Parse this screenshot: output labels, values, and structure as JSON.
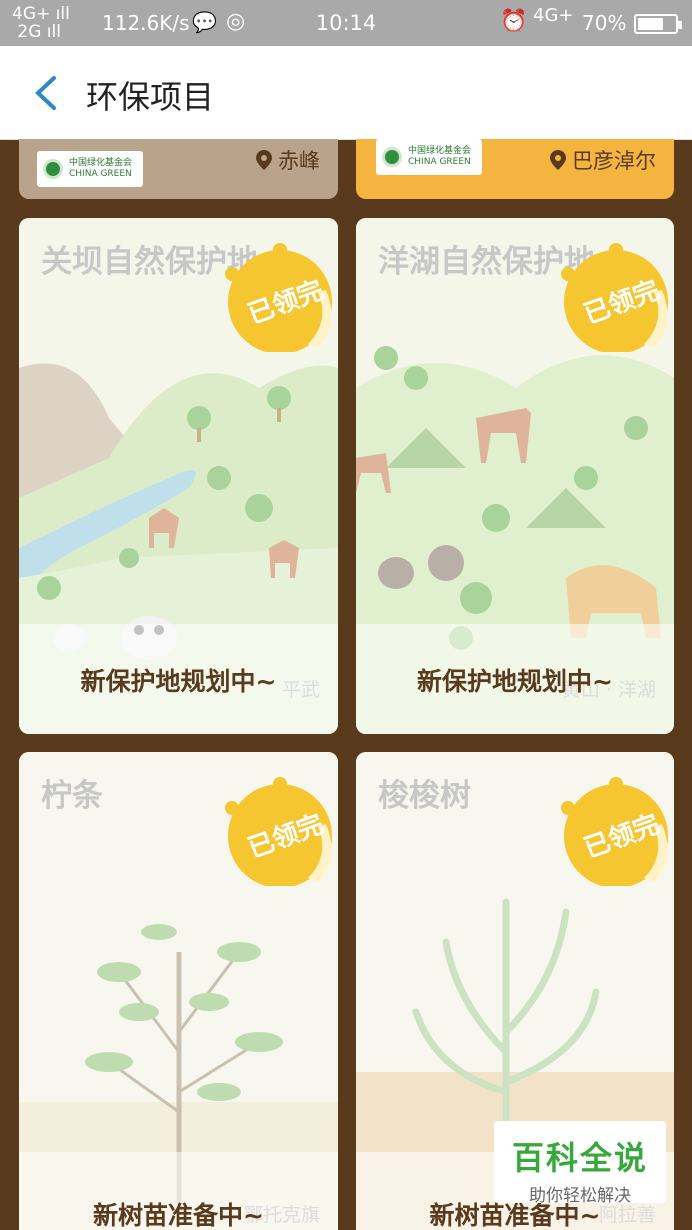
{
  "status": {
    "net_top": "4G+",
    "net_bottom": "2G",
    "speed": "112.6K/s",
    "time": "10:14",
    "net2": "4G+",
    "battery_text": "70%",
    "battery_level": 0.7
  },
  "header": {
    "title": "环保项目"
  },
  "top_cards": [
    {
      "location": "赤峰",
      "bg": "#b9a38b"
    },
    {
      "location": "巴彦淖尔",
      "bg": "#f5b440"
    }
  ],
  "cards": [
    {
      "name": "关坝自然保护地",
      "badge": "已领完",
      "status": "新保护地规划中~",
      "location": "平武"
    },
    {
      "name": "洋湖自然保护地",
      "badge": "已领完",
      "status": "新保护地规划中~",
      "location": "黄山 · 洋湖"
    },
    {
      "name": "柠条",
      "badge": "已领完",
      "status": "新树苗准备中~",
      "location": "鄂托克旗"
    },
    {
      "name": "梭梭树",
      "badge": "已领完",
      "status": "新树苗准备中~",
      "location": "阿拉善"
    }
  ],
  "watermark": {
    "title": "百科全说",
    "subtitle": "助你轻松解决"
  },
  "colors": {
    "accent": "#2f86c9",
    "badge": "#f6c630",
    "status_text": "#5a3a1c"
  }
}
